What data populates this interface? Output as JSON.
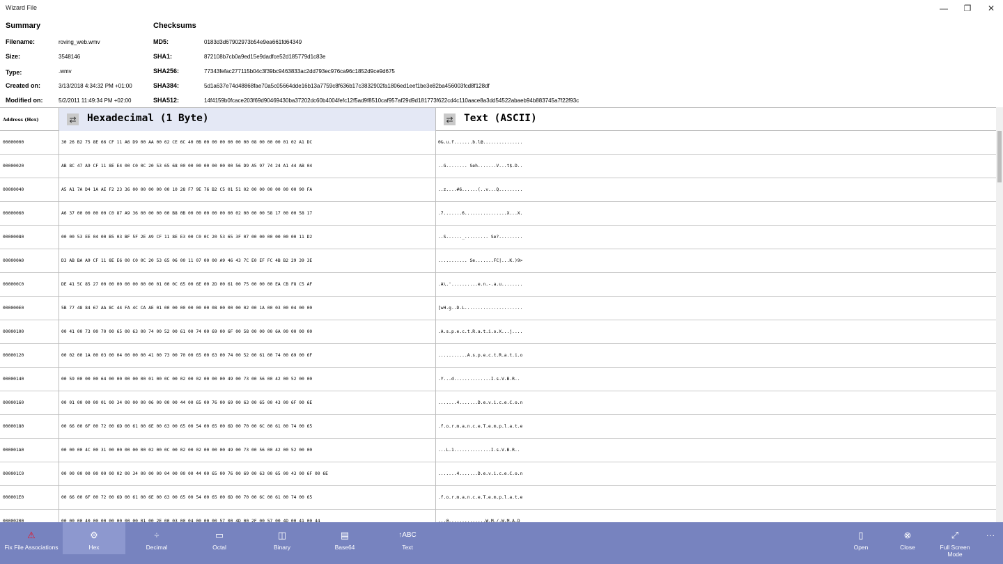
{
  "window": {
    "title": "Wizard File",
    "min": "—",
    "max": "❐",
    "close": "✕"
  },
  "summary": {
    "heading": "Summary",
    "fields": [
      {
        "label": "Filename:",
        "value": "roving_web.wmv"
      },
      {
        "label": "Size:",
        "value": "3548146"
      },
      {
        "label": "Type:",
        "value": ".wmv"
      },
      {
        "label": "Created on:",
        "value": "3/13/2018 4:34:32 PM +01:00"
      },
      {
        "label": "Modified on:",
        "value": "5/2/2011 11:49:34 PM +02:00"
      }
    ]
  },
  "checksums": {
    "heading": "Checksums",
    "fields": [
      {
        "label": "MD5:",
        "value": "0183d3d67902973b54e9ea661fd64349"
      },
      {
        "label": "SHA1:",
        "value": "872108b7cb0a9ed15e9dadfce52d185779d1c83e"
      },
      {
        "label": "SHA256:",
        "value": "77343fefac277115b04c3f39bc9463833ac2dd793ec976ca96c1852d9ce9d675"
      },
      {
        "label": "SHA384:",
        "value": "5d1a637e74d48868fae70a5c05664dde16b13a7759c8f636b17c3832902fa1806ed1eef1be3e82ba456003fcd8f128df"
      },
      {
        "label": "SHA512:",
        "value": "14f4159b0fcace203f69d90469430ba37202dc60b4004fefc12f5ad9f8510caf957af29d9d181773f622cd4c110aace8a3dd54522abaeb94b883745a7f22f93c"
      }
    ]
  },
  "grid": {
    "address_header": "Address (Hex)",
    "hex_header": "Hexadecimal (1 Byte)",
    "text_header": "Text (ASCII)",
    "swap_icon": "⇄",
    "rows": [
      {
        "addr": "00000000",
        "hex": "30 26 B2 75 8E 66 CF 11 A6 D9 00 AA 00 62 CE 6C 40 0B 00 00 00 00 00 00 08 00 00 00 01 02 A1 DC",
        "text": "0&.u.f.......b.l@..............."
      },
      {
        "addr": "00000020",
        "hex": "AB 8C 47 A9 CF 11 8E E4 00 C0 0C 20 53 65 68 00 00 00 00 00 00 00 56 D9 A5 97 74 24 A1 44 AB 04",
        "text": "..G........ Seh.......V...t$.D.."
      },
      {
        "addr": "00000040",
        "hex": "A5 A1 7A D4 1A AE F2 23 36 00 00 00 00 00 10 28 F7 9E 76 B2 C5 01 51 02 00 00 00 00 00 00 90 FA",
        "text": "..z....#6......(..v...Q........."
      },
      {
        "addr": "00000060",
        "hex": "A6 37 00 00 00 00 C0 87 A9 36 00 00 00 00 B8 0B 00 00 00 00 00 00 02 00 00 00 58 17 00 00 58 17",
        "text": ".7.......6................X...X."
      },
      {
        "addr": "00000080",
        "hex": "00 00 53 EE 04 00 B5 03 BF 5F 2E A9 CF 11 8E E3 00 C0 0C 20 53 65 3F 07 00 00 00 00 00 00 11 D2",
        "text": "..S......_......... Se?........."
      },
      {
        "addr": "000000A0",
        "hex": "D3 AB BA A9 CF 11 8E E6 00 C0 0C 20 53 65 06 00 11 07 00 00 A9 46 43 7C E0 EF FC 4B B2 29 39 3E",
        "text": "........... Se.......FC|...K.)9>"
      },
      {
        "addr": "000000C0",
        "hex": "DE 41 5C 85 27 00 00 00 00 00 00 00 01 00 0C 65 00 6E 00 2D 00 61 00 75 00 00 00 EA CB F8 C5 AF",
        "text": ".A\\.'..........e.n.-.a.u........"
      },
      {
        "addr": "000000E0",
        "hex": "5B 77 48 84 67 AA 8C 44 FA 4C CA AE 01 00 00 00 00 00 00 08 00 00 00 02 00 1A 00 03 00 04 00 00",
        "text": "[wH.g..D.L......................"
      },
      {
        "addr": "00000100",
        "hex": "00 41 00 73 00 70 00 65 00 63 00 74 00 52 00 61 00 74 00 69 00 6F 00 58 00 00 00 6A 00 00 00 00",
        "text": ".A.s.p.e.c.t.R.a.t.i.o.X...j...."
      },
      {
        "addr": "00000120",
        "hex": "00 02 00 1A 00 03 00 04 00 00 00 41 00 73 00 70 00 65 00 63 00 74 00 52 00 61 00 74 00 69 00 6F",
        "text": "...........A.s.p.e.c.t.R.a.t.i.o"
      },
      {
        "addr": "00000140",
        "hex": "00 59 00 00 00 64 00 00 00 00 00 01 00 0C 00 02 00 02 00 00 00 49 00 73 00 56 00 42 00 52 00 00",
        "text": ".Y...d..............I.s.V.B.R.."
      },
      {
        "addr": "00000160",
        "hex": "00 01 00 00 00 01 00 34 00 00 00 06 00 00 00 44 00 65 00 76 00 69 00 63 00 65 00 43 00 6F 00 6E",
        "text": ".......4.......D.e.v.i.c.e.C.o.n"
      },
      {
        "addr": "00000180",
        "hex": "00 66 00 6F 00 72 00 6D 00 61 00 6E 00 63 00 65 00 54 00 65 00 6D 00 70 00 6C 00 61 00 74 00 65",
        "text": ".f.o.r.m.a.n.c.e.T.e.m.p.l.a.t.e"
      },
      {
        "addr": "000001A0",
        "hex": "00 00 00 4C 00 31 00 00 00 00 00 02 00 0C 00 02 00 02 00 00 00 49 00 73 00 56 00 42 00 52 00 00",
        "text": "...L.1..............I.s.V.B.R.."
      },
      {
        "addr": "000001C0",
        "hex": "00 00 00 00 00 00 00 02 00 34 00 00 00 04 00 00 00 44 00 65 00 76 00 69 00 63 00 65 00 43 00 6F 00 6E",
        "text": ".......4.......D.e.v.i.c.e.C.o.n"
      },
      {
        "addr": "000001E0",
        "hex": "00 66 00 6F 00 72 00 6D 00 61 00 6E 00 63 00 65 00 54 00 65 00 6D 00 70 00 6C 00 61 00 74 00 65",
        "text": ".f.o.r.m.a.n.c.e.T.e.m.p.l.a.t.e"
      },
      {
        "addr": "00000200",
        "hex": "00 00 00 40 00 00 00 00 00 00 01 00 2E 00 03 00 04 00 00 00 57 00 4D 00 2F 00 57 00 4D 00 41 00 44",
        "text": "...@..............W.M./.W.M.A.D"
      }
    ]
  },
  "toolbar": {
    "fix": {
      "label": "Fix File Associations",
      "icon": "⚠"
    },
    "hex": {
      "label": "Hex",
      "icon": "⚙"
    },
    "decimal": {
      "label": "Decimal",
      "icon": "÷"
    },
    "octal": {
      "label": "Octal",
      "icon": "▭"
    },
    "binary": {
      "label": "Binary",
      "icon": "◫"
    },
    "base64": {
      "label": "Base64",
      "icon": "▤"
    },
    "text": {
      "label": "Text",
      "icon": "↑ABC"
    },
    "open": {
      "label": "Open",
      "icon": "▯"
    },
    "close": {
      "label": "Close",
      "icon": "⊗"
    },
    "fullscreen": {
      "label": "Full Screen Mode",
      "icon": "⤢"
    },
    "more": {
      "icon": "···"
    }
  }
}
